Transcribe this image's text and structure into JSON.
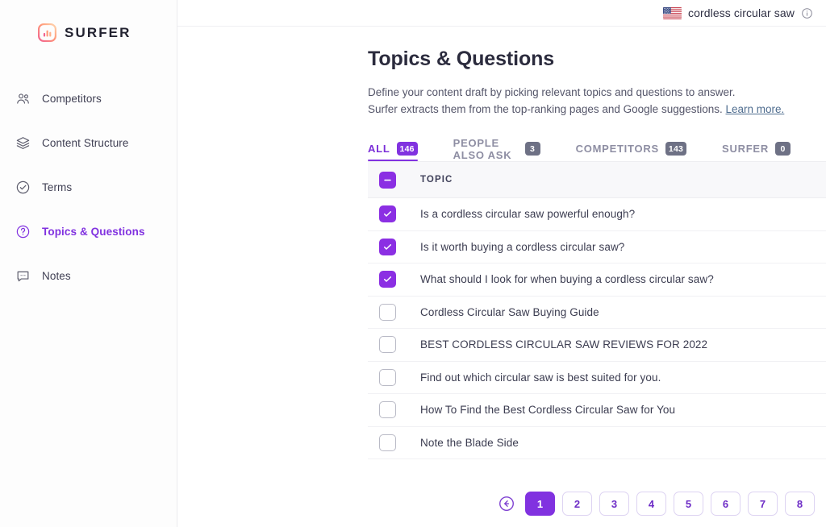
{
  "brand": {
    "name": "SURFER",
    "logo_icon": "surfer-bars-logo",
    "gradient_from": "#ff9a6e",
    "gradient_to": "#f06292"
  },
  "sidebar": {
    "items": [
      {
        "label": "Competitors",
        "icon": "users-icon",
        "active": false
      },
      {
        "label": "Content Structure",
        "icon": "layers-icon",
        "active": false
      },
      {
        "label": "Terms",
        "icon": "check-circle-icon",
        "active": false
      },
      {
        "label": "Topics & Questions",
        "icon": "question-circle-icon",
        "active": true
      },
      {
        "label": "Notes",
        "icon": "comment-dots-icon",
        "active": false
      }
    ]
  },
  "topbar": {
    "flag_icon": "us-flag-icon",
    "keyword": "cordless circular saw",
    "info_icon": "info-circle-icon"
  },
  "main": {
    "title": "Topics & Questions",
    "description_line1": "Define your content draft by picking relevant topics and questions to answer.",
    "description_line2": "Surfer extracts them from the top-ranking pages and Google suggestions.",
    "learn_more": "Learn more."
  },
  "tabs": [
    {
      "label": "ALL",
      "count": "146",
      "active": true
    },
    {
      "label": "PEOPLE ALSO ASK",
      "count": "3",
      "active": false
    },
    {
      "label": "COMPETITORS",
      "count": "143",
      "active": false
    },
    {
      "label": "SURFER",
      "count": "0",
      "active": false
    }
  ],
  "table": {
    "select_all_state": "indeterminate",
    "column_header": "TOPIC",
    "rows": [
      {
        "checked": true,
        "label": "Is a cordless circular saw powerful enough?"
      },
      {
        "checked": true,
        "label": "Is it worth buying a cordless circular saw?"
      },
      {
        "checked": true,
        "label": "What should I look for when buying a cordless circular saw?"
      },
      {
        "checked": false,
        "label": "Cordless Circular Saw Buying Guide"
      },
      {
        "checked": false,
        "label": "BEST CORDLESS CIRCULAR SAW REVIEWS FOR 2022"
      },
      {
        "checked": false,
        "label": "Find out which circular saw is best suited for you."
      },
      {
        "checked": false,
        "label": "How To Find the Best Cordless Circular Saw for You"
      },
      {
        "checked": false,
        "label": "Note the Blade Side"
      }
    ]
  },
  "pagination": {
    "back_icon": "arrow-left-circle-icon",
    "pages": [
      {
        "label": "1",
        "active": true
      },
      {
        "label": "2",
        "active": false
      },
      {
        "label": "3",
        "active": false
      },
      {
        "label": "4",
        "active": false
      },
      {
        "label": "5",
        "active": false
      },
      {
        "label": "6",
        "active": false
      },
      {
        "label": "7",
        "active": false
      },
      {
        "label": "8",
        "active": false
      }
    ]
  },
  "colors": {
    "accent": "#8132e0",
    "accent_dark": "#6d2cc6",
    "text": "#3b3c50",
    "muted": "#8e8ea3"
  }
}
